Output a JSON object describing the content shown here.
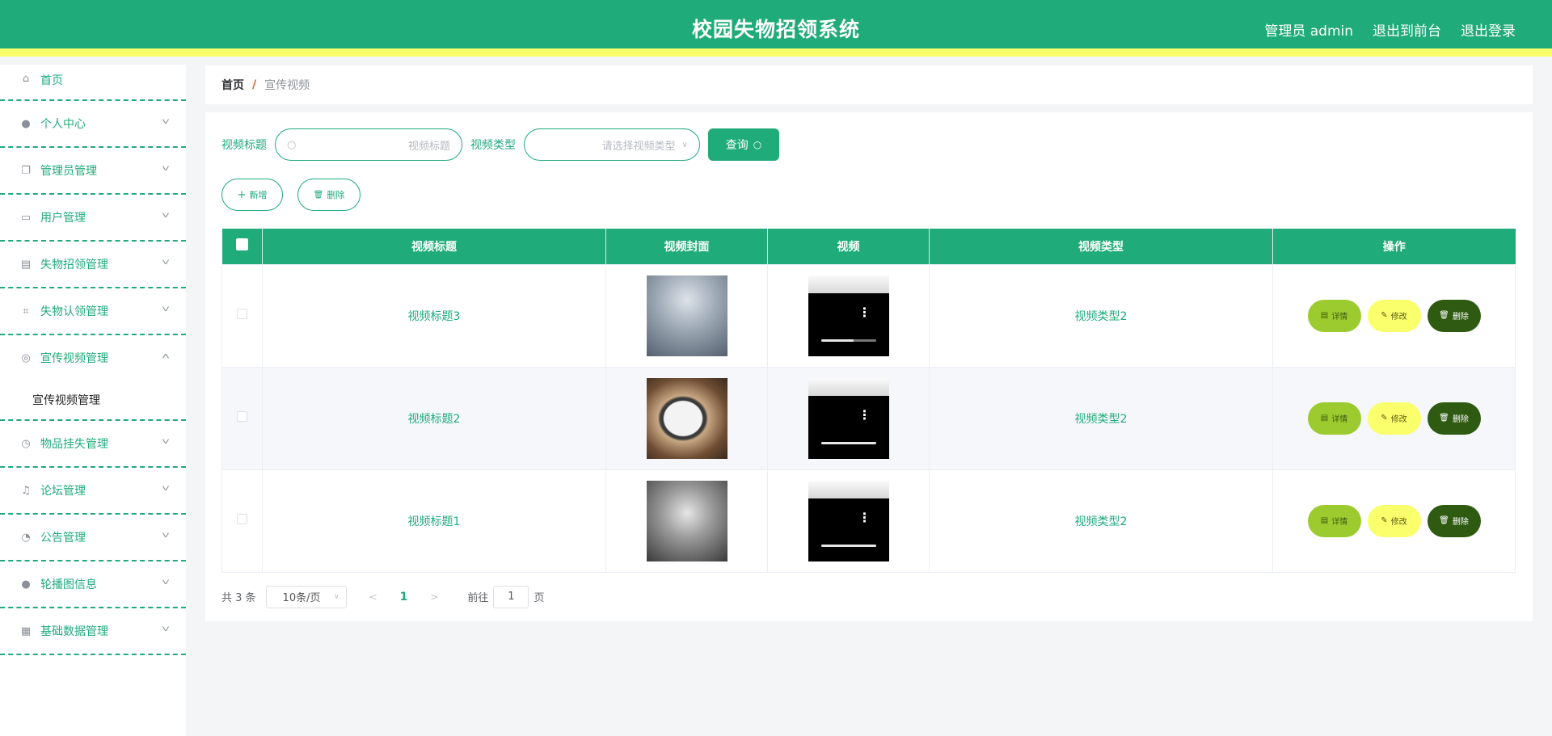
{
  "header": {
    "title": "校园失物招领系统",
    "user": "管理员 admin",
    "front": "退出到前台",
    "logout": "退出登录"
  },
  "sidebar": {
    "items": [
      {
        "label": "首页",
        "icon": "home-icon"
      },
      {
        "label": "个人中心",
        "icon": "user-icon"
      },
      {
        "label": "管理员管理",
        "icon": "copy-icon"
      },
      {
        "label": "用户管理",
        "icon": "chat-icon"
      },
      {
        "label": "失物招领管理",
        "icon": "clipboard-icon"
      },
      {
        "label": "失物认领管理",
        "icon": "crop-icon"
      },
      {
        "label": "宣传视频管理",
        "icon": "compass-icon"
      },
      {
        "label": "物品挂失管理",
        "icon": "clock-icon"
      },
      {
        "label": "论坛管理",
        "icon": "bell-off-icon"
      },
      {
        "label": "公告管理",
        "icon": "odometer-icon"
      },
      {
        "label": "轮播图信息",
        "icon": "user-solid-icon"
      },
      {
        "label": "基础数据管理",
        "icon": "grid-icon"
      }
    ],
    "submenu": "宣传视频管理"
  },
  "breadcrumb": {
    "home": "首页",
    "sep": "/",
    "current": "宣传视频"
  },
  "search": {
    "title_label": "视频标题",
    "title_placeholder": "视频标题",
    "type_label": "视频类型",
    "type_placeholder": "请选择视频类型",
    "query": "查询"
  },
  "actions": {
    "add": "新增",
    "delete": "删除"
  },
  "table": {
    "headers": [
      "视频标题",
      "视频封面",
      "视频",
      "视频类型",
      "操作"
    ],
    "rows": [
      {
        "title": "视频标题3",
        "type": "视频类型2",
        "progress": 0.6
      },
      {
        "title": "视频标题2",
        "type": "视频类型2",
        "progress": 1.0
      },
      {
        "title": "视频标题1",
        "type": "视频类型2",
        "progress": 1.0
      }
    ],
    "ops": {
      "detail": "详情",
      "edit": "修改",
      "delete": "删除"
    }
  },
  "pager": {
    "total": "共 3 条",
    "size": "10条/页",
    "page": "1",
    "goto": "前往",
    "goto_value": "1",
    "unit": "页"
  },
  "colors": {
    "accent": "#1fab7a",
    "topbar_border": "#f8ff6a",
    "detail": "#9ccb2f",
    "edit": "#faff6c",
    "delete": "#2e5a12"
  }
}
